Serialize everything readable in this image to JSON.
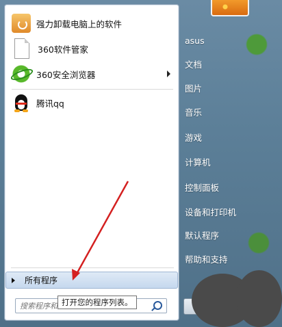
{
  "programs": [
    {
      "label": "强力卸载电脑上的软件",
      "icon": "uninstall-icon",
      "has_submenu": false
    },
    {
      "label": "360软件管家",
      "icon": "document-icon",
      "has_submenu": false
    },
    {
      "label": "360安全浏览器",
      "icon": "browser-icon",
      "has_submenu": true
    },
    {
      "label": "腾讯qq",
      "icon": "qq-penguin-icon",
      "has_submenu": false
    }
  ],
  "all_programs": {
    "label": "所有程序"
  },
  "search": {
    "placeholder": "搜索程序和"
  },
  "tooltip": {
    "text": "打开您的程序列表。"
  },
  "right_items": [
    {
      "label": "asus"
    },
    {
      "label": "文档"
    },
    {
      "label": "图片"
    },
    {
      "label": "音乐"
    },
    {
      "label": "游戏"
    },
    {
      "label": "计算机"
    },
    {
      "label": "控制面板"
    },
    {
      "label": "设备和打印机"
    },
    {
      "label": "默认程序"
    },
    {
      "label": "帮助和支持"
    }
  ],
  "colors": {
    "annotation_arrow": "#d42020",
    "pane_white": "#ffffff",
    "right_text": "#ffffff"
  }
}
